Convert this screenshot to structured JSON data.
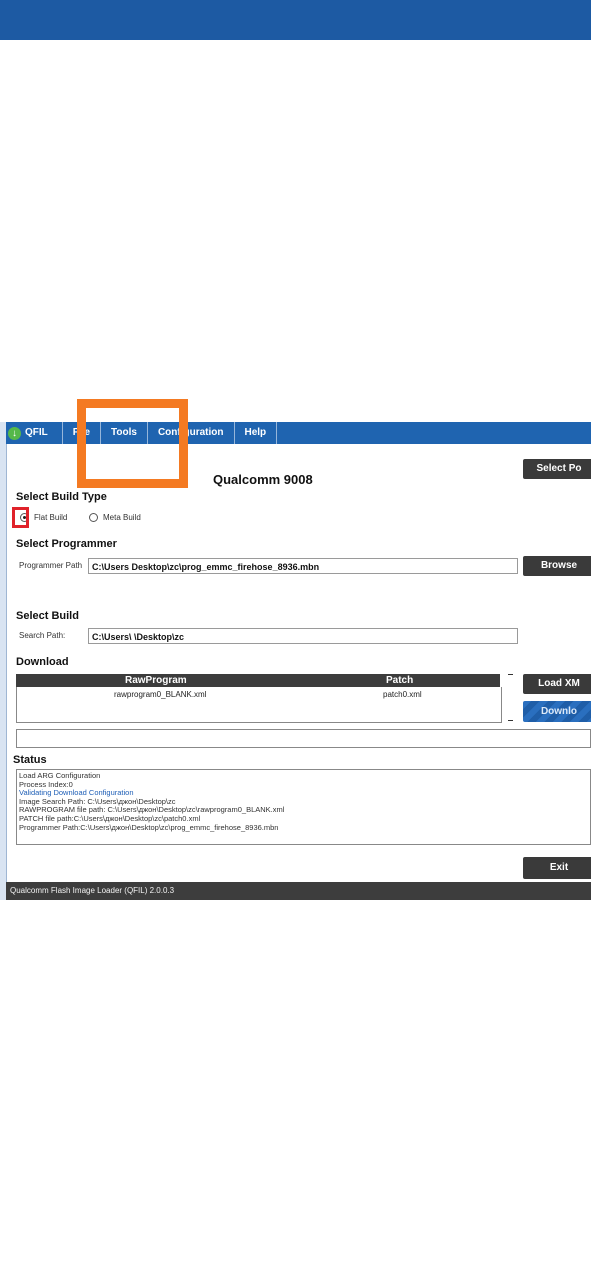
{
  "menu": {
    "app_name": "QFIL",
    "items": [
      "File",
      "Tools",
      "Configuration",
      "Help"
    ]
  },
  "device": "Qualcomm 9008",
  "buttons": {
    "select_port": "Select Po",
    "browse": "Browse",
    "load_xml": "Load XM",
    "download": "Downlo",
    "exit": "Exit"
  },
  "build_type": {
    "title": "Select Build Type",
    "flat": "Flat Build",
    "meta": "Meta Build"
  },
  "programmer": {
    "title": "Select Programmer",
    "label": "Programmer Path",
    "value": "C:\\Users        Desktop\\zc\\prog_emmc_firehose_8936.mbn"
  },
  "build": {
    "title": "Select Build",
    "label": "Search Path:",
    "value": "C:\\Users\\        \\Desktop\\zc"
  },
  "download": {
    "title": "Download",
    "columns": [
      "RawProgram",
      "Patch"
    ],
    "rows": [
      {
        "rawprogram": "rawprogram0_BLANK.xml",
        "patch": "patch0.xml"
      }
    ]
  },
  "status": {
    "title": "Status",
    "lines": [
      "Load ARG Configuration",
      "Process Index:0",
      "Validating Download Configuration",
      "Image Search Path: C:\\Users\\джон\\Desktop\\zc",
      "RAWPROGRAM file path: C:\\Users\\джон\\Desktop\\zc\\rawprogram0_BLANK.xml",
      "PATCH file path:C:\\Users\\джон\\Desktop\\zc\\patch0.xml",
      "Programmer Path:C:\\Users\\джон\\Desktop\\zc\\prog_emmc_firehose_8936.mbn"
    ]
  },
  "footer": "Qualcomm Flash Image Loader (QFIL)   2.0.0.3",
  "colors": {
    "header_blue": "#1d5aa3",
    "menu_blue": "#1f64b0",
    "annotation_orange": "#f47a22",
    "annotation_red": "#e0222a"
  }
}
